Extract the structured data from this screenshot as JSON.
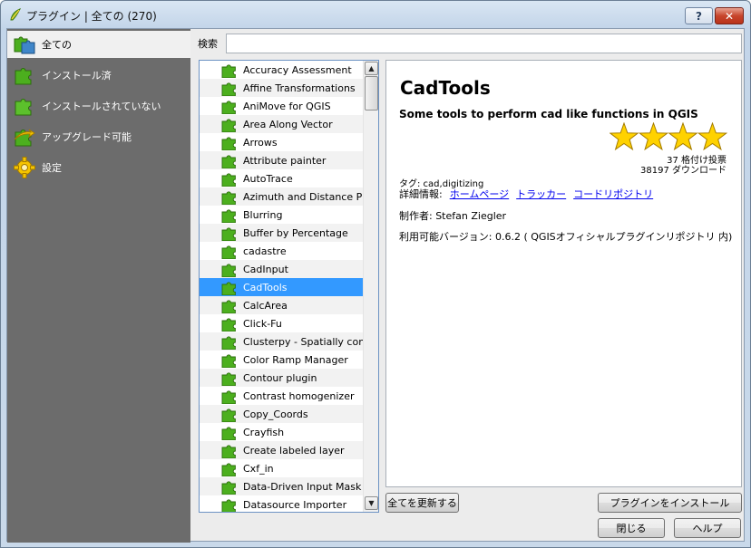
{
  "window": {
    "title": "プラグイン | 全ての (270)",
    "help_button": "?",
    "close_button": "✕"
  },
  "sidebar": {
    "items": [
      {
        "label": "全ての",
        "icon": "plugins-all-icon",
        "active": true
      },
      {
        "label": "インストール済",
        "icon": "plugin-installed-icon",
        "active": false
      },
      {
        "label": "インストールされていない",
        "icon": "plugin-not-installed-icon",
        "active": false
      },
      {
        "label": "アップグレード可能",
        "icon": "plugin-upgrade-icon",
        "active": false
      },
      {
        "label": "設定",
        "icon": "settings-gear-icon",
        "active": false
      }
    ]
  },
  "search": {
    "label": "検索",
    "value": "",
    "placeholder": ""
  },
  "plugin_list": {
    "selected": "CadTools",
    "items": [
      "Accuracy Assessment",
      "Affine Transformations",
      "AniMove for QGIS",
      "Area Along Vector",
      "Arrows",
      "Attribute painter",
      "AutoTrace",
      "Azimuth and Distance Plu",
      "Blurring",
      "Buffer by Percentage",
      "cadastre",
      "CadInput",
      "CadTools",
      "CalcArea",
      "Click-Fu",
      "Clusterpy - Spatially cons",
      "Color Ramp Manager",
      "Contour plugin",
      "Contrast homogenizer",
      "Copy_Coords",
      "Crayfish",
      "Create labeled layer",
      "Cxf_in",
      "Data-Driven Input Mask",
      "Datasource Importer"
    ]
  },
  "details": {
    "title": "CadTools",
    "description": "Some tools to perform cad like functions in QGIS",
    "rating_stars": 4,
    "votes": "37 格付け投票",
    "downloads": "38197 ダウンロード",
    "tags": "タグ: cad,digitizing",
    "more_info_label": "詳細情報:",
    "links": [
      "ホームページ",
      "トラッカー",
      "コードリポジトリ"
    ],
    "author": "制作者: Stefan Ziegler",
    "version": "利用可能バージョン: 0.6.2 ( QGISオフィシャルプラグインリポジトリ 内)"
  },
  "buttons": {
    "upgrade_all": "全てを更新する",
    "install": "プラグインをインストール",
    "close": "閉じる",
    "help": "ヘルプ"
  },
  "colors": {
    "accent_selection": "#3399ff",
    "sidebar_bg": "#6c6c6c",
    "plugin_green": "#4caf1e",
    "star_yellow": "#ffd200"
  }
}
